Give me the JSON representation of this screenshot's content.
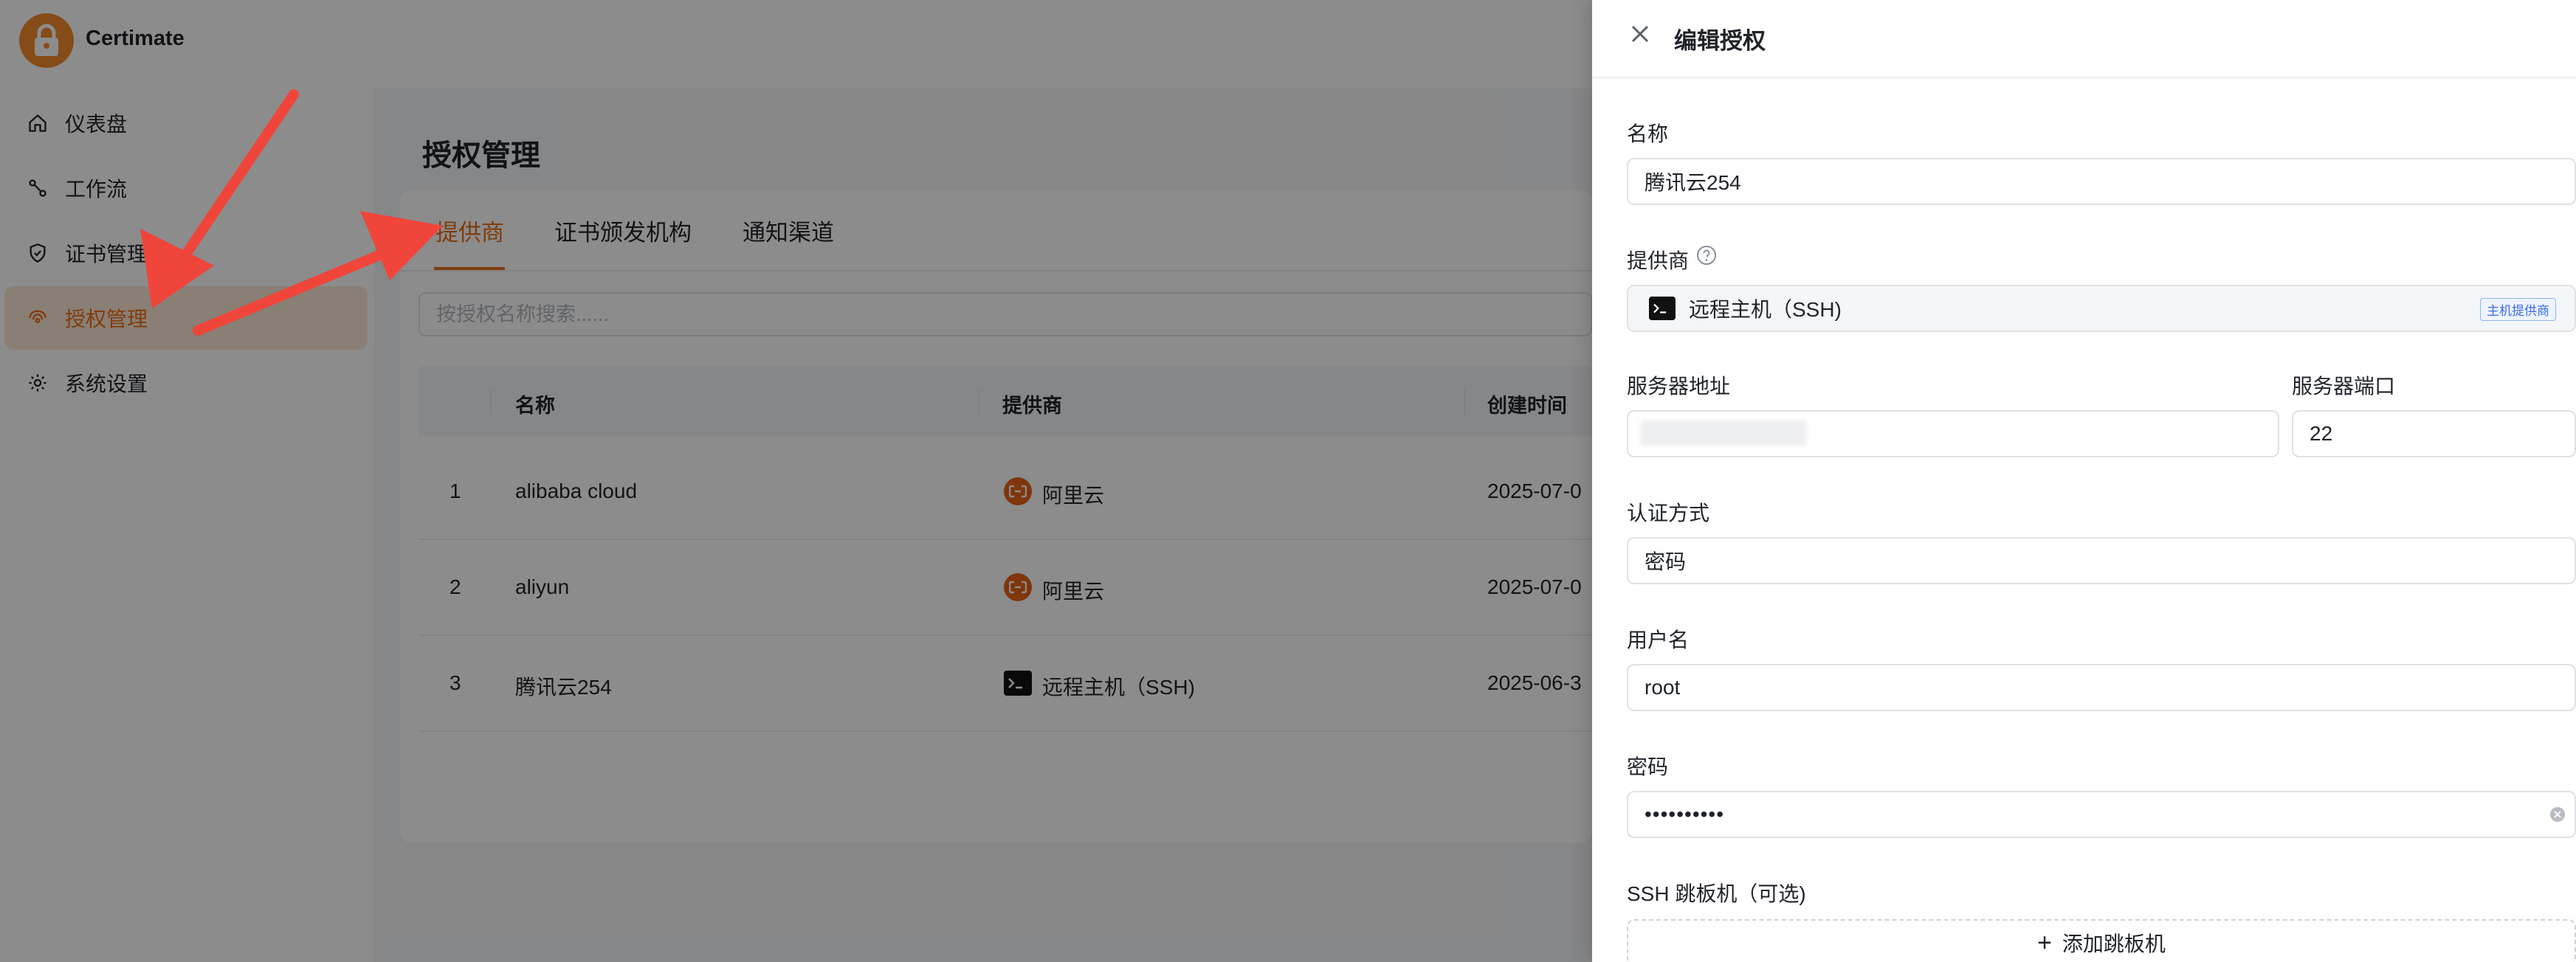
{
  "app": {
    "name": "Certimate"
  },
  "sidebar": {
    "items": [
      {
        "label": "仪表盘",
        "icon": "home-icon"
      },
      {
        "label": "工作流",
        "icon": "workflow-icon"
      },
      {
        "label": "证书管理",
        "icon": "shield-check-icon"
      },
      {
        "label": "授权管理",
        "icon": "fingerprint-icon",
        "active": true
      },
      {
        "label": "系统设置",
        "icon": "gear-icon"
      }
    ]
  },
  "page": {
    "title": "授权管理",
    "tabs": [
      {
        "label": "提供商",
        "active": true
      },
      {
        "label": "证书颁发机构"
      },
      {
        "label": "通知渠道"
      }
    ],
    "search_placeholder": "按授权名称搜索......",
    "table": {
      "columns": [
        "名称",
        "提供商",
        "创建时间"
      ],
      "rows": [
        {
          "index": "1",
          "name": "alibaba cloud",
          "provider": "阿里云",
          "provider_icon": "aliyun-icon",
          "created": "2025-07-0"
        },
        {
          "index": "2",
          "name": "aliyun",
          "provider": "阿里云",
          "provider_icon": "aliyun-icon",
          "created": "2025-07-0"
        },
        {
          "index": "3",
          "name": "腾讯云254",
          "provider": "远程主机（SSH)",
          "provider_icon": "terminal-icon",
          "created": "2025-06-3"
        }
      ]
    }
  },
  "drawer": {
    "title": "编辑授权",
    "fields": {
      "name_label": "名称",
      "name_value": "腾讯云254",
      "provider_label": "提供商",
      "provider_value": "远程主机（SSH)",
      "provider_badge": "主机提供商",
      "host_label": "服务器地址",
      "host_value": "",
      "port_label": "服务器端口",
      "port_value": "22",
      "auth_label": "认证方式",
      "auth_value": "密码",
      "username_label": "用户名",
      "username_value": "root",
      "password_label": "密码",
      "password_value": "••••••••••",
      "jump_label": "SSH 跳板机（可选)",
      "jump_button": "添加跳板机"
    }
  },
  "colors": {
    "accent": "#ea6d17",
    "annotation_arrow": "#f0453a"
  }
}
